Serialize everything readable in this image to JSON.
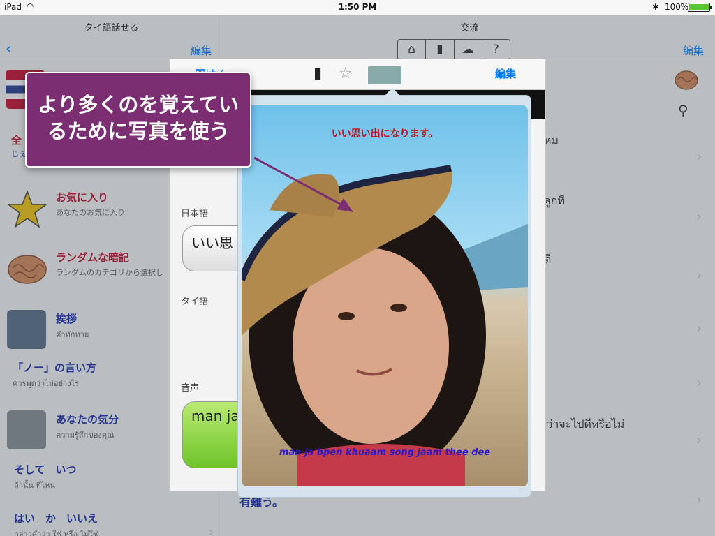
{
  "status": {
    "device": "iPad",
    "time": "1:50 PM",
    "battery": "100%",
    "battery_level": 1.0
  },
  "left": {
    "title": "タイ語話せる",
    "back": "‹",
    "edit": "編集",
    "partial_title": "全",
    "partial_sub": "じぇ",
    "items": [
      {
        "title": "お気に入り",
        "sub": "あなたのお気に入り"
      },
      {
        "title": "ランダムな暗記",
        "sub": "ランダムのカテゴリから選択し"
      },
      {
        "title": "挨拶",
        "sub": "คำทักทาย"
      },
      {
        "title": "「ノー」の言い方",
        "sub": "ควรพูดว่าไม่อย่างไร"
      },
      {
        "title": "あなたの気分",
        "sub": "ความรู้สึกของคุณ"
      },
      {
        "title": "そして　いつ",
        "sub": "ถ้านั้น ที่ไหน"
      },
      {
        "title": "はい　か　いいえ",
        "sub": "กล่าวคำว่า ใช่ หรือ ไม่ใช่"
      }
    ]
  },
  "right": {
    "title": "交流",
    "edit": "編集",
    "seg_icons": [
      "basket-icon",
      "bottle-icon",
      "cloud-icon",
      "question-icon"
    ],
    "seg_glyphs": [
      "⌂",
      "▮",
      "☁",
      "?"
    ],
    "thai_lines": [
      "หม",
      "ลูกที",
      "ดี",
      "ยู่ว่าจะไปดีหรือไม่"
    ],
    "bottom_text": "有難う。"
  },
  "popover": {
    "open": "開ける",
    "edit": "編集",
    "label_japanese": "日本語",
    "japanese_text": "いい思",
    "label_thai": "タイ語",
    "label_audio": "音声",
    "audio_text": "man ja"
  },
  "photo": {
    "caption_top": "いい思い出になります。",
    "caption_bottom": "man ja bpen khuaam song jaam thee dee"
  },
  "callout": {
    "text_line1": "より多くのを覚えてい",
    "text_line2": "るために写真を使う"
  }
}
